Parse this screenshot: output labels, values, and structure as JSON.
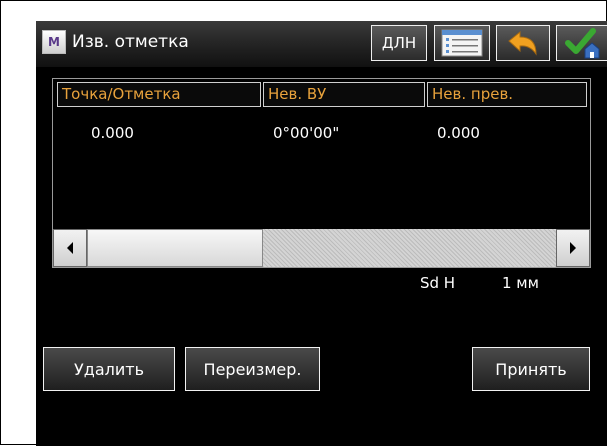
{
  "titlebar": {
    "title": "Изв. отметка",
    "app_icon_letter": "M",
    "dln_label": "ДЛН",
    "icons": [
      "list-icon",
      "undo-arrow-icon",
      "checkmark-house-icon"
    ]
  },
  "table": {
    "columns": [
      "Точка/Отметка",
      "Нев. ВУ",
      "Нев. прев."
    ],
    "rows": [
      [
        "0.000",
        "0°00'00\"",
        "0.000"
      ]
    ]
  },
  "sd": {
    "label": "Sd H",
    "value": "1 мм"
  },
  "buttons": {
    "delete": "Удалить",
    "resize": "Переизмер.",
    "accept": "Принять"
  },
  "colors": {
    "header_text": "#e8a23c",
    "background": "#000000",
    "ok_green": "#3aa832",
    "undo_orange": "#f0a020"
  }
}
